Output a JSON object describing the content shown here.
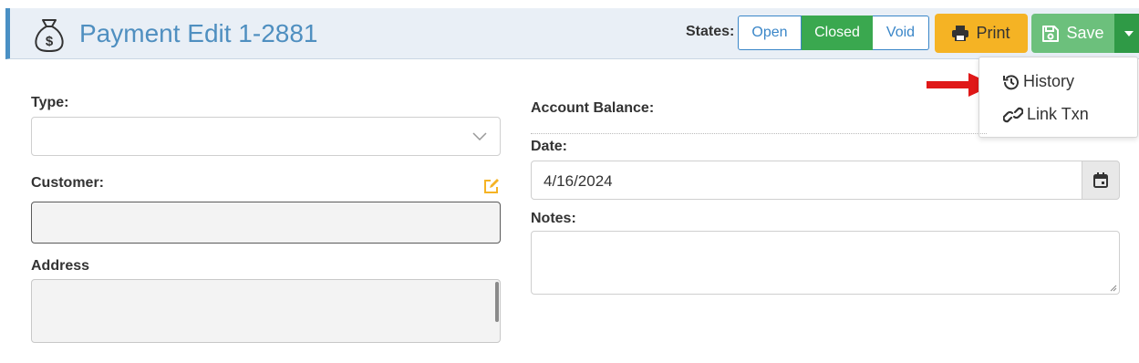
{
  "header": {
    "title": "Payment Edit 1-2881",
    "states_label": "States:",
    "states": [
      {
        "label": "Open",
        "active": false
      },
      {
        "label": "Closed",
        "active": true
      },
      {
        "label": "Void",
        "active": false
      }
    ],
    "print_label": "Print",
    "save_label": "Save"
  },
  "save_menu": {
    "items": [
      {
        "label": "History",
        "icon": "history-icon"
      },
      {
        "label": "Link Txn",
        "icon": "link-icon"
      }
    ]
  },
  "form": {
    "type_label": "Type:",
    "type_value": "",
    "customer_label": "Customer:",
    "customer_value": "",
    "address_label": "Address",
    "address_value": "",
    "account_balance_label": "Account Balance:",
    "account_balance_value": "",
    "date_label": "Date:",
    "date_value": "4/16/2024",
    "notes_label": "Notes:",
    "notes_value": ""
  },
  "colors": {
    "accent_blue": "#4f8fc0",
    "closed_green": "#3aa84f",
    "print_orange": "#f5b324",
    "save_green": "#6cc07c",
    "annotation_red": "#e01818"
  }
}
